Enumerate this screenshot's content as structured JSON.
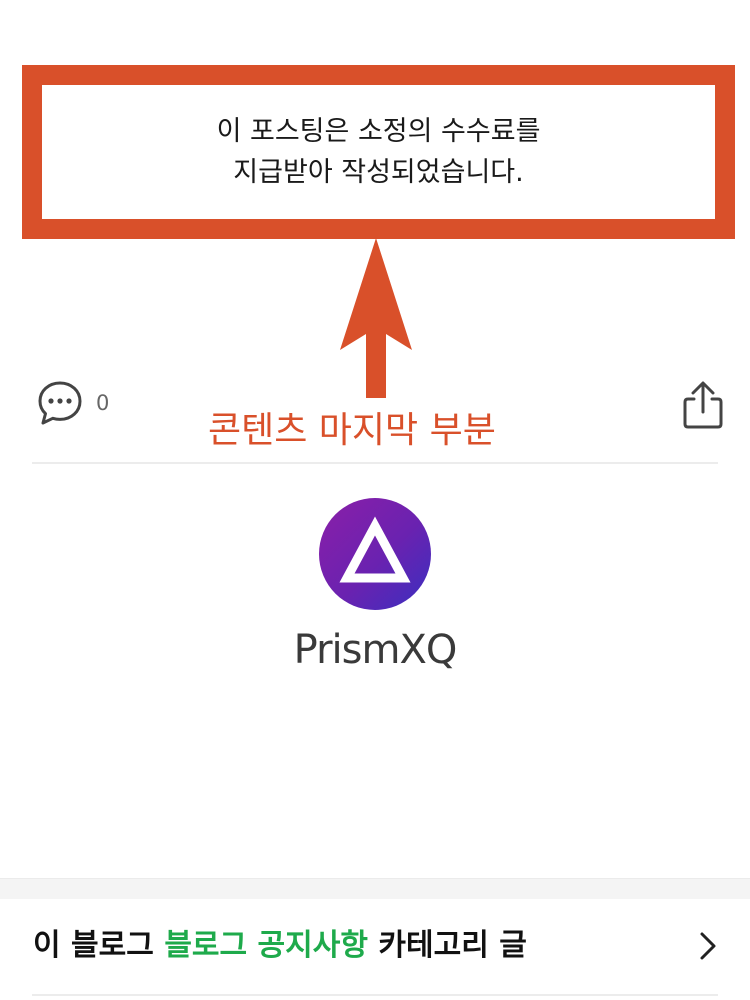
{
  "disclosure": {
    "line1": "이 포스팅은 소정의 수수료를",
    "line2": "지급받아 작성되었습니다."
  },
  "annotation": {
    "label": "콘텐츠 마지막 부분",
    "color": "#d9502a"
  },
  "actions": {
    "comment_icon": "comment-bubble-icon",
    "comment_count": "0",
    "share_icon": "share-icon"
  },
  "profile": {
    "avatar_icon": "triangle-logo-icon",
    "blog_name": "PrismXQ"
  },
  "category_link": {
    "prefix": "이 블로그",
    "category": "블로그 공지사항",
    "suffix": "카테고리 글",
    "category_color": "#1eaa4b",
    "arrow_icon": "chevron-right-icon"
  }
}
